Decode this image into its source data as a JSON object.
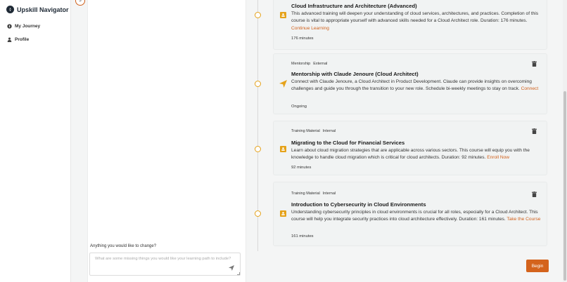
{
  "app": {
    "title": "Upskill Navigator"
  },
  "nav": [
    {
      "label": "My Journey",
      "icon": "compass-icon"
    },
    {
      "label": "Profile",
      "icon": "user-icon"
    }
  ],
  "chat": {
    "step_number": "3",
    "change_label": "Anything you would like to change?",
    "input_placeholder": "What are some missing things you would like your learning path to include?"
  },
  "items": [
    {
      "icon": "book-icon",
      "tags": [],
      "title": "Cloud Infrastructure and Architecture (Advanced)",
      "description": "This advanced training will deepen your understanding of cloud services, architectures, and practices. Completion of this course is vital to appropriate yourself with advanced skills needed for a Cloud Architect role. Duration: 176 minutes.",
      "link": "Continue Learning",
      "meta": "176 minutes"
    },
    {
      "icon": "send-icon",
      "tags": [
        "Mentorship",
        "External"
      ],
      "title": "Mentorship with Claude Jenoure (Cloud Architect)",
      "description": "Connect with Claude Jenoure, a Cloud Architect in Product Development. Claude can provide insights on overcoming challenges and guide you through the transition to your new role. Schedule bi-weekly meetings to stay on track.",
      "link": "Connect",
      "meta": "Ongoing"
    },
    {
      "icon": "book-icon",
      "tags": [
        "Training Material",
        "Internal"
      ],
      "title": "Migrating to the Cloud for Financial Services",
      "description": "Learn about cloud migration strategies that are applicable across various sectors. This course will equip you with the knowledge to handle cloud migration which is critical for cloud architects. Duration: 92 minutes.",
      "link": "Enroll Now",
      "meta": "92 minutes"
    },
    {
      "icon": "book-icon",
      "tags": [
        "Training Material",
        "Internal"
      ],
      "title": "Introduction to Cybersecurity in Cloud Environments",
      "description": "Understanding cybersecurity principles in cloud environments is crucial for all roles, especially for a Cloud Architect. This course will help you integrate security practices into cloud architecture effectively. Duration: 161 minutes.",
      "link": "Take the Course",
      "meta": "161 minutes"
    }
  ],
  "actions": {
    "begin_label": "Begin"
  },
  "colors": {
    "accent": "#d4631c",
    "node": "#e5a21a",
    "brand": "#1f2a36"
  }
}
